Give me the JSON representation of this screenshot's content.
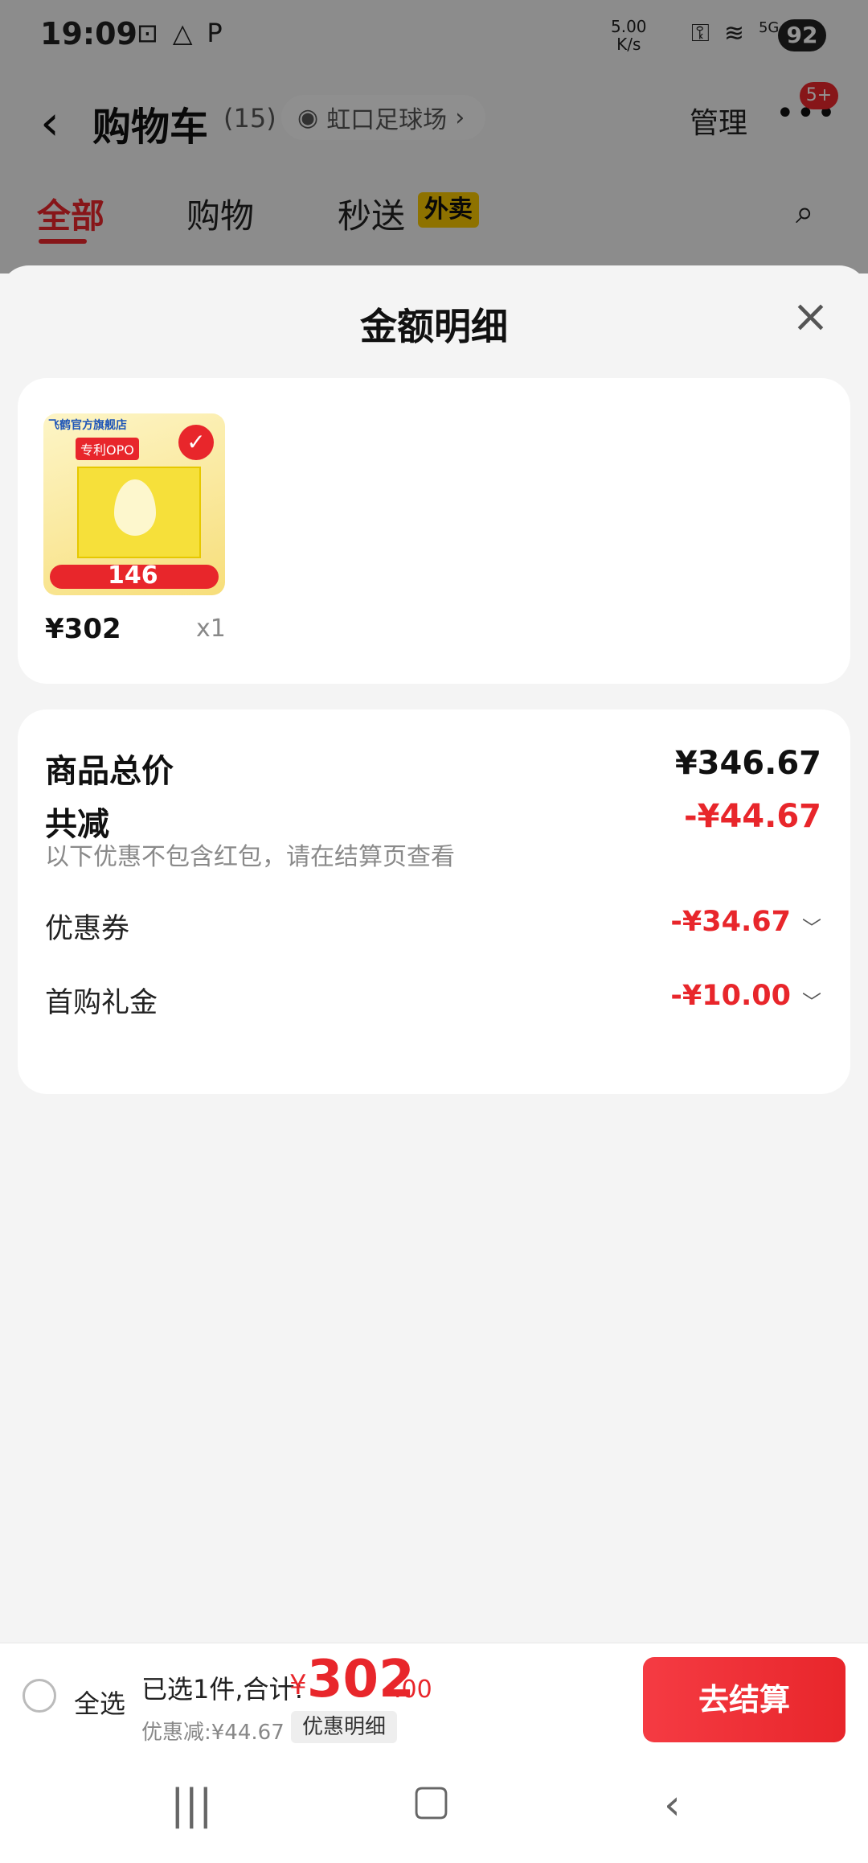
{
  "status_bar": {
    "time": "19:09",
    "left_icons": [
      "⊡",
      "△",
      "P"
    ],
    "net_speed_value": "5.00",
    "net_speed_unit": "K/s",
    "signal": "5G",
    "battery": "92"
  },
  "nav": {
    "back_glyph": "‹",
    "title": "购物车",
    "count": "(15)",
    "location": "虹口足球场",
    "manage": "管理",
    "more_badge": "5+"
  },
  "tabs": {
    "all": "全部",
    "shopping": "购物",
    "fast_delivery": "秒送",
    "fast_tag": "外卖"
  },
  "sheet": {
    "title": "金额明细",
    "close": "×",
    "item": {
      "store_label": "飞鹤官方旗舰店",
      "opo_label": "专利OPO",
      "thumb_price": "146",
      "price": "¥302",
      "qty": "x1"
    },
    "breakdown": {
      "total_label": "商品总价",
      "total_value": "¥346.67",
      "reduce_label": "共减",
      "reduce_value": "-¥44.67",
      "reduce_note": "以下优惠不包含红包，请在结算页查看",
      "coupon_label": "优惠券",
      "coupon_value": "-¥34.67",
      "gift_label": "首购礼金",
      "gift_value": "-¥10.00"
    }
  },
  "checkout": {
    "select_all": "全选",
    "selected_text": "已选1件,合计:",
    "currency": "¥",
    "amount_int": "302",
    "amount_dec": ".00",
    "discount_text": "优惠减:¥44.67",
    "discount_detail": "优惠明细",
    "pay_button": "去结算"
  },
  "colors": {
    "accent_red": "#e8262b",
    "tag_yellow": "#f5c400"
  }
}
